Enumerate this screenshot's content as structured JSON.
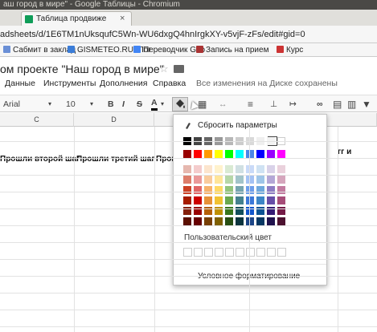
{
  "window": {
    "title": "аш город в мире\" - Google Таблицы - Chromium"
  },
  "tab": {
    "label": "Таблица продвиже",
    "close": "×"
  },
  "url": "adsheets/d/1E6TM1nUksqufC5Wn-WU6dxgQ4hnIrgkXY-v5vjF-zFs/edit#gid=0",
  "bookmarks": [
    {
      "label": "Сабмит в заклад",
      "color": "#6a8fd6"
    },
    {
      "label": "GISMETEO.RU: Пог",
      "color": "#3b7dd8"
    },
    {
      "label": "Переводчик Goo",
      "color": "#4285f4"
    },
    {
      "label": "Запись на прием",
      "color": "#a33"
    },
    {
      "label": "Курс",
      "color": "#c33"
    }
  ],
  "doc": {
    "title": "ом проекте \"Наш город в мире\"",
    "star": "☆"
  },
  "menu": [
    "Данные",
    "Инструменты",
    "Дополнения",
    "Справка"
  ],
  "save_status": "Все изменения на Диске сохранены",
  "toolbar": {
    "font": "Arial",
    "size": "10",
    "bold": "B",
    "italic": "I",
    "strike": "S",
    "textcolor": "A"
  },
  "columns": [
    {
      "letter": "C",
      "header": "Прошли второй шаг"
    },
    {
      "letter": "D",
      "header": "Прошли третий шаг"
    },
    {
      "letter": "",
      "header": "Проц"
    }
  ],
  "right_header_fragment": "гг и",
  "palette": {
    "reset_label": "Сбросить параметры",
    "check": "✓",
    "custom_label": "Пользовательский цвет",
    "conditional_label": "Условное форматирование",
    "grays": [
      "#000000",
      "#434343",
      "#666666",
      "#999999",
      "#b7b7b7",
      "#cccccc",
      "#d9d9d9",
      "#efefef",
      "#f3f3f3",
      "#ffffff"
    ],
    "brights": [
      "#980000",
      "#ff0000",
      "#ff9900",
      "#ffff00",
      "#00ff00",
      "#00ffff",
      "#4a86e8",
      "#0000ff",
      "#9900ff",
      "#ff00ff"
    ],
    "shades": [
      [
        "#e6b8af",
        "#f4cccc",
        "#fce5cd",
        "#fff2cc",
        "#d9ead3",
        "#d0e0e3",
        "#c9daf8",
        "#cfe2f3",
        "#d9d2e9",
        "#ead1dc"
      ],
      [
        "#dd7e6b",
        "#ea9999",
        "#f9cb9c",
        "#ffe599",
        "#b6d7a8",
        "#a2c4c9",
        "#a4c2f4",
        "#9fc5e8",
        "#b4a7d6",
        "#d5a6bd"
      ],
      [
        "#cc4125",
        "#e06666",
        "#f6b26b",
        "#ffd966",
        "#93c47d",
        "#76a5af",
        "#6d9eeb",
        "#6fa8dc",
        "#8e7cc3",
        "#c27ba0"
      ],
      [
        "#a61c00",
        "#cc0000",
        "#e69138",
        "#f1c232",
        "#6aa84f",
        "#45818e",
        "#3c78d8",
        "#3d85c6",
        "#674ea7",
        "#a64d79"
      ],
      [
        "#85200c",
        "#990000",
        "#b45f06",
        "#bf9000",
        "#38761d",
        "#134f5c",
        "#1155cc",
        "#0b5394",
        "#351c75",
        "#741b47"
      ],
      [
        "#5b0f00",
        "#660000",
        "#783f04",
        "#7f6000",
        "#274e13",
        "#0c343d",
        "#1c4587",
        "#073763",
        "#20124d",
        "#4c1130"
      ]
    ],
    "custom_slots": 10
  }
}
